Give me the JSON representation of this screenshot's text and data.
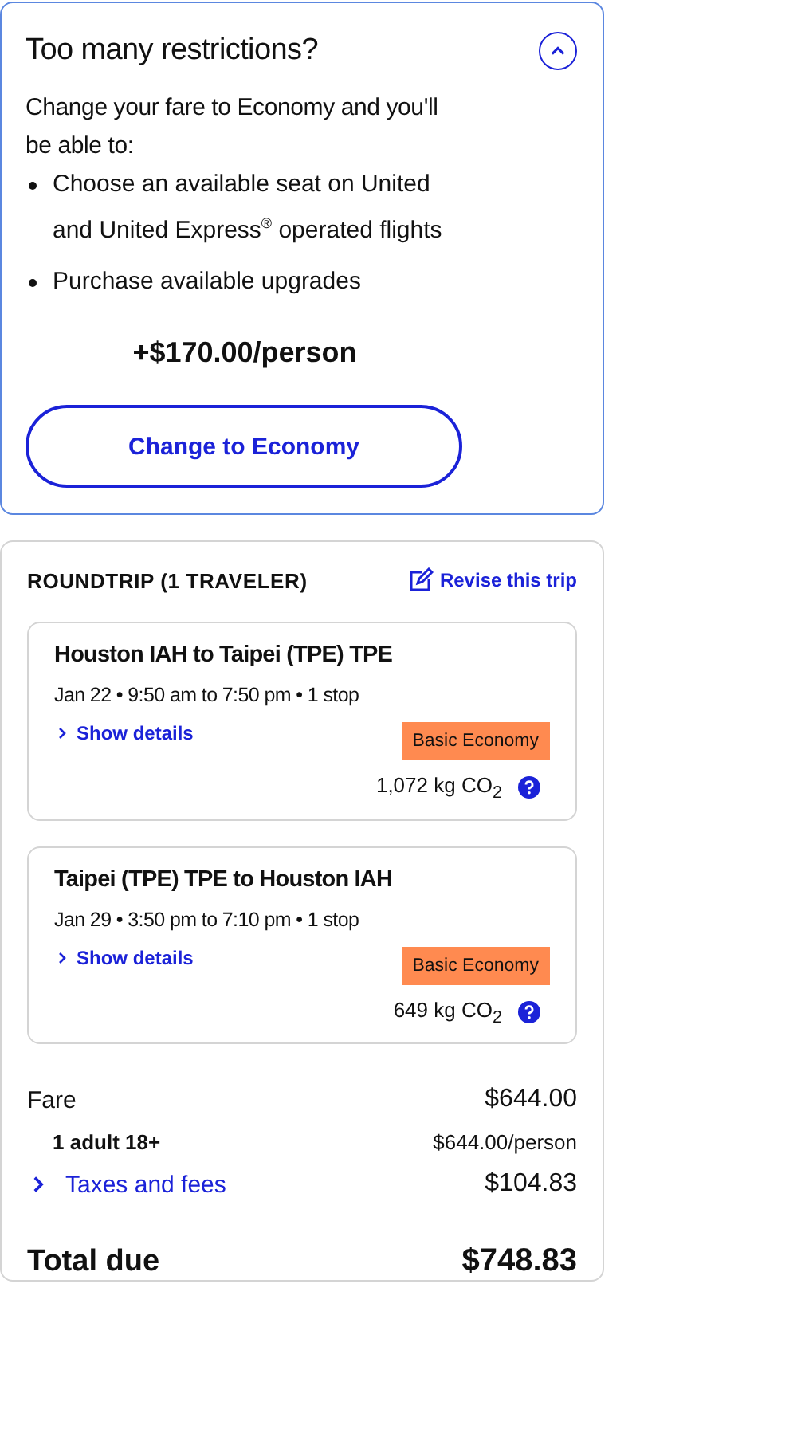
{
  "upsell": {
    "title": "Too many restrictions?",
    "expanded": true,
    "intro": "Change your fare to Economy and you'll be able to:",
    "benefits": [
      "Choose an available seat on United and United Express$^{®}$ operated flights",
      "Purchase available upgrades"
    ],
    "price": "+$170.00/person",
    "button": "Change to Economy"
  },
  "trip": {
    "heading": "ROUNDTRIP (1 TRAVELER)",
    "revise_link": "Revise this trip",
    "flights": [
      {
        "route": "Houston IAH to Taipei (TPE) TPE",
        "schedule": "Jan 22 • 9:50 am to 7:50 pm • 1 stop",
        "details_link": "Show details",
        "fare_badge": "Basic Economy",
        "emissions": "1,072 kg CO$_{2}$"
      },
      {
        "route": "Taipei (TPE) TPE to Houston IAH",
        "schedule": "Jan 29 • 3:50 pm to 7:10 pm • 1 stop",
        "details_link": "Show details",
        "fare_badge": "Basic Economy",
        "emissions": "649 kg CO$_{2}$"
      }
    ],
    "price_lines": [
      {
        "kind": "main",
        "label": "Fare",
        "amount": "$644.00"
      },
      {
        "kind": "sub",
        "label": "1 adult 18+",
        "amount": "$644.00/person"
      },
      {
        "kind": "link",
        "label": "Taxes and fees",
        "amount": "$104.83"
      },
      {
        "kind": "total",
        "label": "Total due",
        "amount": "$748.83"
      }
    ]
  }
}
